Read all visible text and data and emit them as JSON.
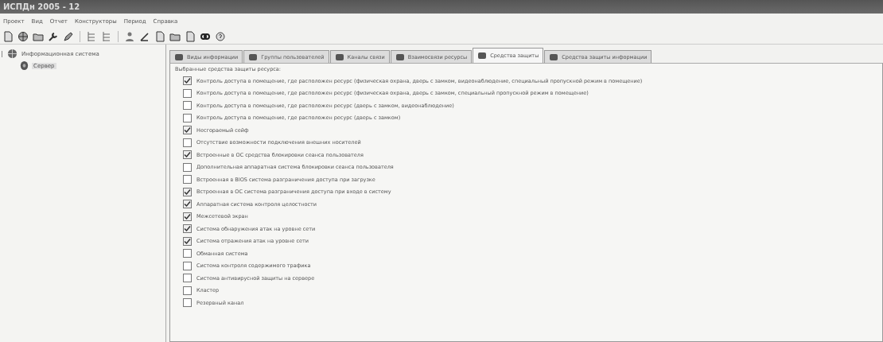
{
  "window": {
    "title": "ИСПДн 2005 - 12"
  },
  "menu": [
    "Проект",
    "Вид",
    "Отчет",
    "Конструкторы",
    "Период",
    "Справка"
  ],
  "tree": [
    {
      "label": "Информационная система",
      "expanded": true,
      "children": [
        {
          "label": "Сервер",
          "selected": true
        }
      ]
    }
  ],
  "tabs": [
    {
      "label": "Виды информации",
      "selected": false
    },
    {
      "label": "Группы пользователей",
      "selected": false
    },
    {
      "label": "Каналы связи",
      "selected": false
    },
    {
      "label": "Взаимосвязи ресурсы",
      "selected": false
    },
    {
      "label": "Средства защиты",
      "selected": true
    },
    {
      "label": "Средства защиты информации",
      "selected": false
    }
  ],
  "list_label": "Выбранные средства защиты ресурса:",
  "items": [
    {
      "label": "Контроль доступа в помещение, где расположен ресурс (физическая охрана, дверь с замком, видеонаблюдение, специальный пропускной режим в помещение)",
      "checked": true
    },
    {
      "label": "Контроль доступа в помещение, где расположен ресурс (физическая охрана, дверь с замком, специальный пропускной режим в помещение)",
      "checked": false
    },
    {
      "label": "Контроль доступа в помещение, где расположен ресурс (дверь с замком, видеонаблюдение)",
      "checked": false
    },
    {
      "label": "Контроль доступа в помещение, где расположен ресурс (дверь с замком)",
      "checked": false
    },
    {
      "label": "Несгораемый сейф",
      "checked": true
    },
    {
      "label": "Отсутствие возможности подключения внешних носителей",
      "checked": false
    },
    {
      "label": "Встроенные в ОС средства блокировки сеанса пользователя",
      "checked": true
    },
    {
      "label": "Дополнительная аппаратная система блокировки сеанса пользователя",
      "checked": false
    },
    {
      "label": "Встроенная в BIOS система разграничения доступа при загрузке",
      "checked": false
    },
    {
      "label": "Встроенная в ОС система разграничения доступа при входе в систему",
      "checked": true
    },
    {
      "label": "Аппаратная система контроля целостности",
      "checked": true
    },
    {
      "label": "Межсетевой экран",
      "checked": true
    },
    {
      "label": "Система обнаружения атак на уровне сети",
      "checked": true
    },
    {
      "label": "Система отражения атак на уровне сети",
      "checked": true
    },
    {
      "label": "Обманная система",
      "checked": false
    },
    {
      "label": "Система контроля содержимого трафика",
      "checked": false
    },
    {
      "label": "Система антивирусной защиты на сервере",
      "checked": false
    },
    {
      "label": "Кластер",
      "checked": false
    },
    {
      "label": "Резервный канал",
      "checked": false
    }
  ]
}
